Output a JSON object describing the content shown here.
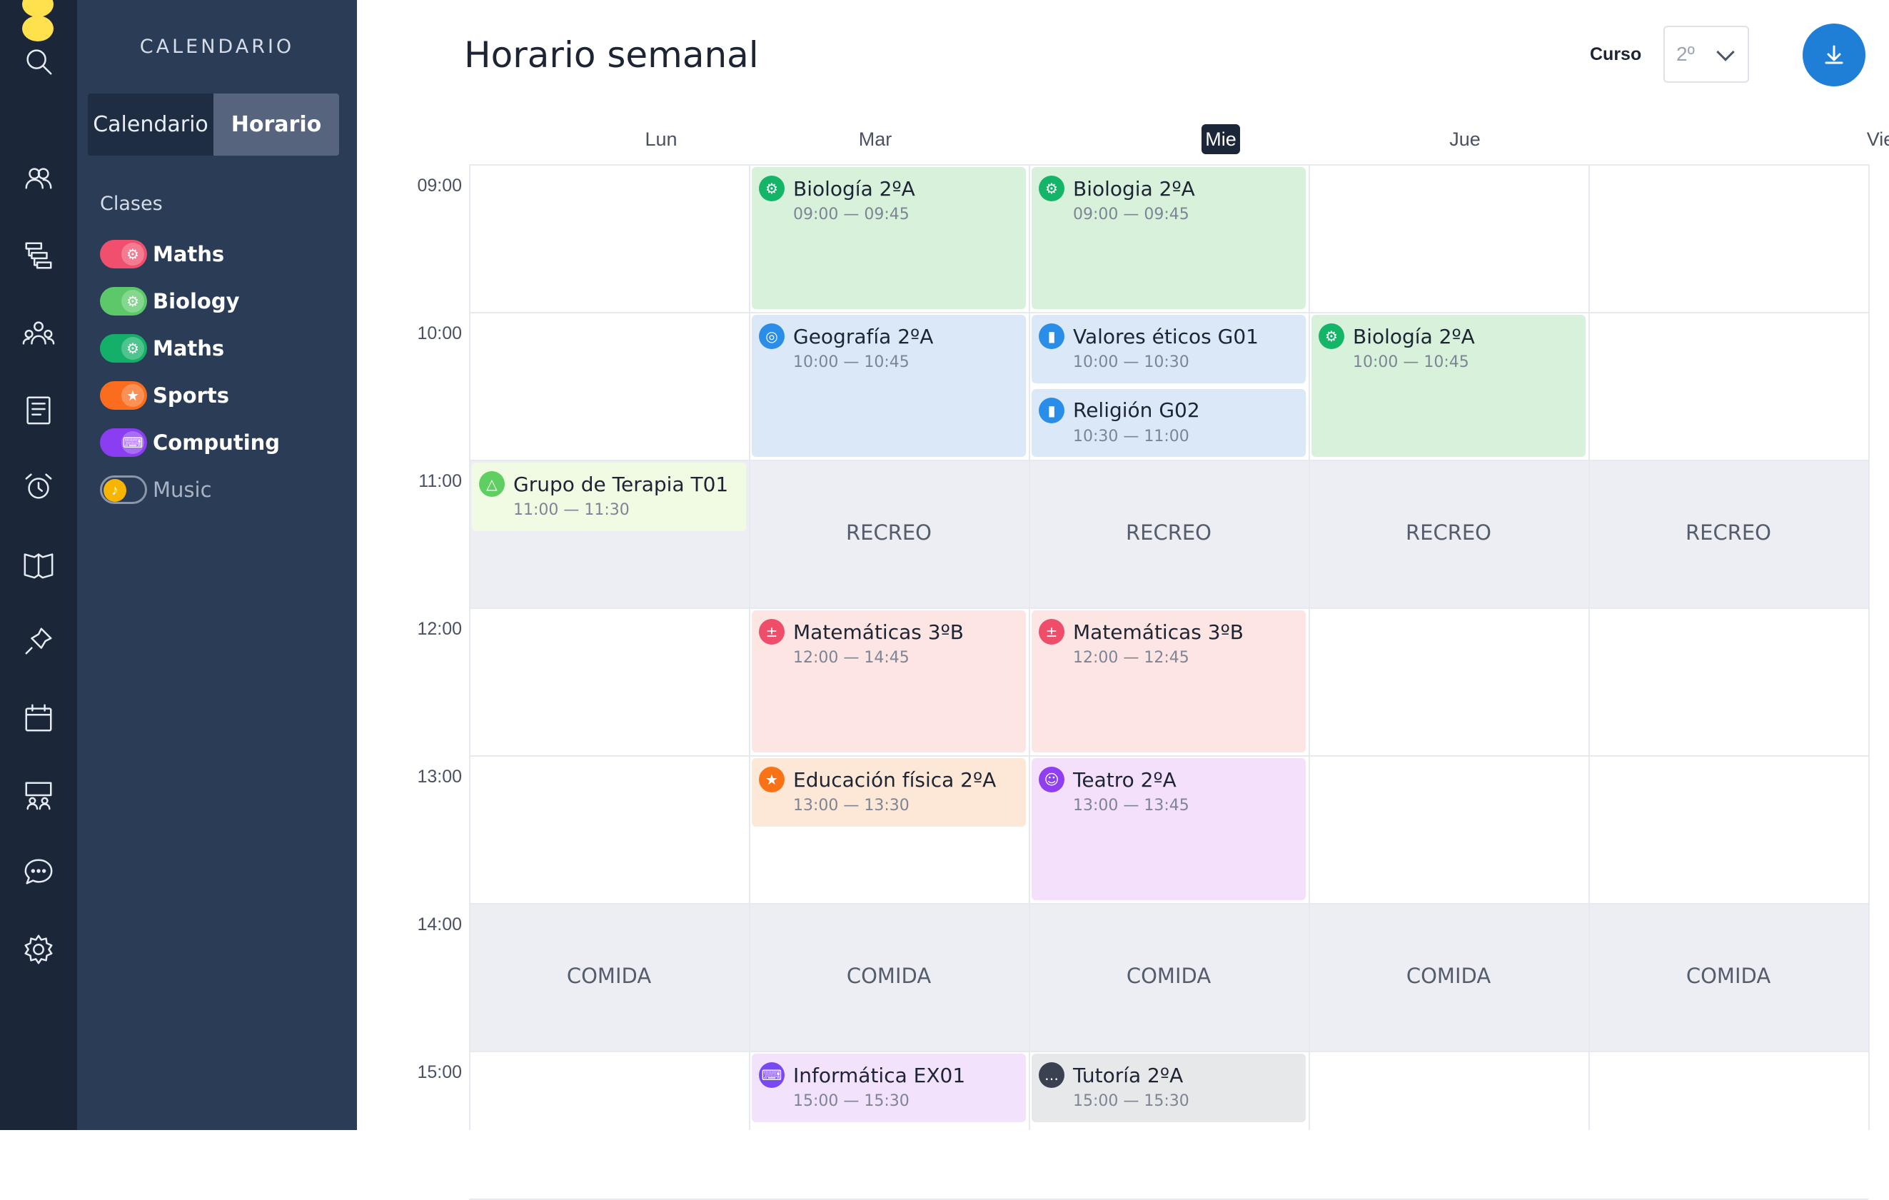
{
  "sidebar": {
    "title": "CALENDARIO",
    "toggle": [
      "Calendario",
      "Horario"
    ],
    "clases_label": "Clases",
    "classes": [
      {
        "label": "Maths",
        "color": "#f0506e",
        "icon": "gear-bug-icon",
        "on": true
      },
      {
        "label": "Biology",
        "color": "#5cc86a",
        "icon": "gear-bug-icon",
        "on": true
      },
      {
        "label": "Maths",
        "color": "#14b06a",
        "icon": "gear-bug-icon",
        "on": true
      },
      {
        "label": "Sports",
        "color": "#fb6d1e",
        "icon": "runner-icon",
        "on": true
      },
      {
        "label": "Computing",
        "color": "#8b3df2",
        "icon": "keyboard-icon",
        "on": true
      },
      {
        "label": "Music",
        "color": "#f7b500",
        "icon": "music-note-icon",
        "on": false
      }
    ]
  },
  "header": {
    "title": "Horario semanal",
    "curso_label": "Curso",
    "curso_value": "2º"
  },
  "days": [
    "Lun",
    "Mar",
    "Mie",
    "Jue",
    "Vie"
  ],
  "today": "Mie",
  "times": [
    "09:00",
    "10:00",
    "11:00",
    "12:00",
    "13:00",
    "14:00",
    "15:00"
  ],
  "breaks": {
    "recreo": "RECREO",
    "comida": "COMIDA"
  },
  "events": [
    {
      "title": "Biología 2ºA",
      "time": "09:00 — 09:45",
      "day": 1,
      "start": "09:00",
      "end": "10:00",
      "color": "green",
      "icon": "gear-bug-icon"
    },
    {
      "title": "Biologia 2ºA",
      "time": "09:00 — 09:45",
      "day": 2,
      "start": "09:00",
      "end": "10:00",
      "color": "green",
      "icon": "gear-bug-icon"
    },
    {
      "title": "Geografía 2ºA",
      "time": "10:00 — 10:45",
      "day": 1,
      "start": "10:00",
      "end": "11:00",
      "color": "blue",
      "icon": "globe-icon"
    },
    {
      "title": "Valores éticos G01",
      "time": "10:00 — 10:30",
      "day": 2,
      "start": "10:00",
      "end": "10:30",
      "color": "blue",
      "icon": "book-icon"
    },
    {
      "title": "Religión G02",
      "time": "10:30 — 11:00",
      "day": 2,
      "start": "10:30",
      "end": "11:00",
      "color": "blue",
      "icon": "book-icon"
    },
    {
      "title": "Biología 2ºA",
      "time": "10:00 — 10:45",
      "day": 3,
      "start": "10:00",
      "end": "11:00",
      "color": "green",
      "icon": "gear-bug-icon"
    },
    {
      "title": "Grupo de Terapia T01",
      "time": "11:00 — 11:30",
      "day": 0,
      "start": "11:00",
      "end": "11:30",
      "color": "lime",
      "icon": "triangle-icon"
    },
    {
      "title": "Matemáticas 3ºB",
      "time": "12:00 — 14:45",
      "day": 1,
      "start": "12:00",
      "end": "13:00",
      "color": "salmon",
      "icon": "calc-icon"
    },
    {
      "title": "Matemáticas 3ºB",
      "time": "12:00 — 12:45",
      "day": 2,
      "start": "12:00",
      "end": "13:00",
      "color": "salmon",
      "icon": "calc-icon"
    },
    {
      "title": "Educación física 2ºA",
      "time": "13:00 — 13:30",
      "day": 1,
      "start": "13:00",
      "end": "13:30",
      "color": "peach",
      "icon": "runner-icon"
    },
    {
      "title": "Teatro 2ºA",
      "time": "13:00 — 13:45",
      "day": 2,
      "start": "13:00",
      "end": "14:00",
      "color": "violet",
      "icon": "mask-icon"
    },
    {
      "title": "Informática EX01",
      "time": "15:00 — 15:30",
      "day": 1,
      "start": "15:00",
      "end": "15:30",
      "color": "lilac",
      "icon": "keyboard-icon"
    },
    {
      "title": "Tutoría 2ºA",
      "time": "15:00 — 15:30",
      "day": 2,
      "start": "15:00",
      "end": "15:30",
      "color": "gray",
      "icon": "chat-icon"
    }
  ]
}
